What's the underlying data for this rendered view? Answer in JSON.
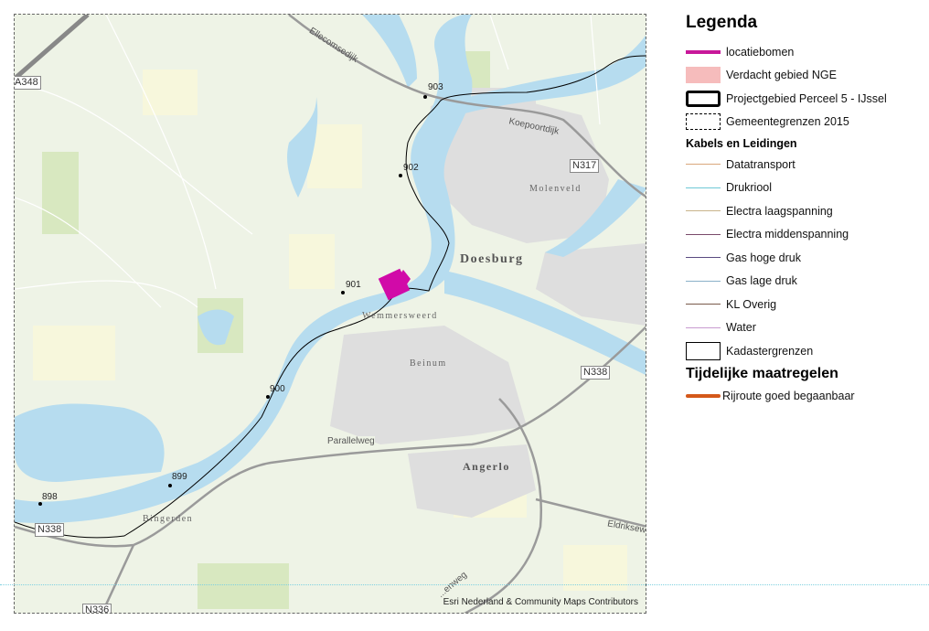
{
  "map": {
    "km_markers": [
      "898",
      "899",
      "900",
      "901",
      "902",
      "903"
    ],
    "places": {
      "doesburg": "Doesburg",
      "molenveld": "Molenveld",
      "wemmersweerd": "Wemmersweerd",
      "beinum": "Beinum",
      "angerlo": "Angerlo",
      "bingerden": "Bingerden"
    },
    "roads": {
      "ellecomsedijk": "Ellecomsedijk",
      "koepoortdijk": "Koepoortdijk",
      "parallelweg": "Parallelweg",
      "eldriksew": "Eldriksew",
      "zomerweg": "...enweg"
    },
    "shields": {
      "a348": "A348",
      "n317": "N317",
      "n338_right": "N338",
      "n338_left": "N338",
      "n336": "N336"
    },
    "attribution": "Esri Nederland & Community Maps Contributors",
    "colors": {
      "water": "#b6dcef",
      "land": "#eef3e6",
      "urban": "#dedede",
      "location": "#d10aa8",
      "boundary": "#000000"
    }
  },
  "legend": {
    "title": "Legenda",
    "items": [
      {
        "label": "locatiebomen",
        "symbol": "thick-line",
        "color": "#c8189a"
      },
      {
        "label": "Verdacht gebied NGE",
        "symbol": "fill",
        "color": "#f6bcbc"
      },
      {
        "label": "Projectgebied Perceel 5 - IJssel",
        "symbol": "thick-outline",
        "color": "#000000"
      },
      {
        "label": "Gemeentegrenzen 2015",
        "symbol": "dashed-outline",
        "color": "#000000"
      }
    ],
    "section1": "Kabels en Leidingen",
    "cables": [
      {
        "label": "Datatransport",
        "color": "#d9a77c"
      },
      {
        "label": "Drukriool",
        "color": "#6fc9d6"
      },
      {
        "label": "Electra laagspanning",
        "color": "#c9b48a"
      },
      {
        "label": "Electra middenspanning",
        "color": "#7a4a6a"
      },
      {
        "label": "Gas hoge druk",
        "color": "#5a4a80"
      },
      {
        "label": "Gas lage druk",
        "color": "#8ab0c8"
      },
      {
        "label": "KL Overig",
        "color": "#7a5a4a"
      },
      {
        "label": "Water",
        "color": "#c89ad0"
      },
      {
        "label": "Kadastergrenzen",
        "color": "#000000"
      }
    ],
    "section2": "Tijdelijke maatregelen",
    "measures": [
      {
        "label": "Rijroute goed begaanbaar",
        "color": "#d4581a"
      }
    ]
  }
}
